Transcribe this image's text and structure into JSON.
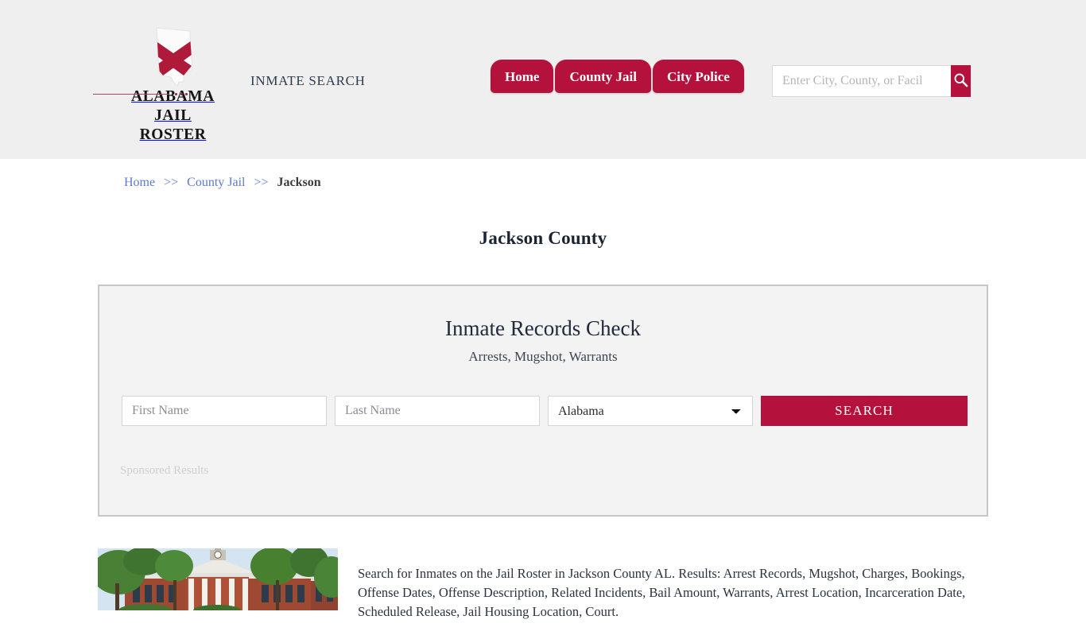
{
  "header": {
    "brand": {
      "line1": "ALABAMA",
      "line2": "JAIL ROSTER",
      "mark_icon": "alabama-state-outline-icon"
    },
    "tagline": "INMATE SEARCH",
    "nav": [
      {
        "label": "Home"
      },
      {
        "label": "County Jail"
      },
      {
        "label": "City Police"
      }
    ],
    "search": {
      "placeholder": "Enter City, County, or Facil",
      "value": "",
      "button_icon": "search-icon"
    },
    "background_color": "#efefef"
  },
  "breadcrumb": {
    "items": [
      {
        "label": "Home",
        "link": true
      },
      {
        "label": "County Jail",
        "link": true
      },
      {
        "label": "Jackson",
        "link": false
      }
    ],
    "separator": ">>"
  },
  "page": {
    "title": "Jackson County"
  },
  "records_panel": {
    "heading": "Inmate Records Check",
    "subheading": "Arrests, Mugshot, Warrants",
    "form": {
      "first_name_placeholder": "First Name",
      "first_name_value": "",
      "last_name_placeholder": "Last Name",
      "last_name_value": "",
      "state_selected": "Alabama",
      "state_options": [
        "Alabama"
      ],
      "submit_label": "SEARCH"
    },
    "sponsored_label": "Sponsored Results"
  },
  "content": {
    "photo_alt": "jackson-county-courthouse-photo",
    "description": "Search for Inmates on the Jail Roster in Jackson County AL. Results: Arrest Records, Mugshot, Charges, Bookings, Offense Dates, Offense Description, Related Incidents, Bail Amount, Warrants, Arrest Location, Incarceration Date, Scheduled Release, Jail Housing Location, Court."
  },
  "colors": {
    "brand_red": "#b4123c",
    "header_bg": "#efefef",
    "panel_bg": "#f3f3f3",
    "link_blue": "#5b78d8"
  }
}
